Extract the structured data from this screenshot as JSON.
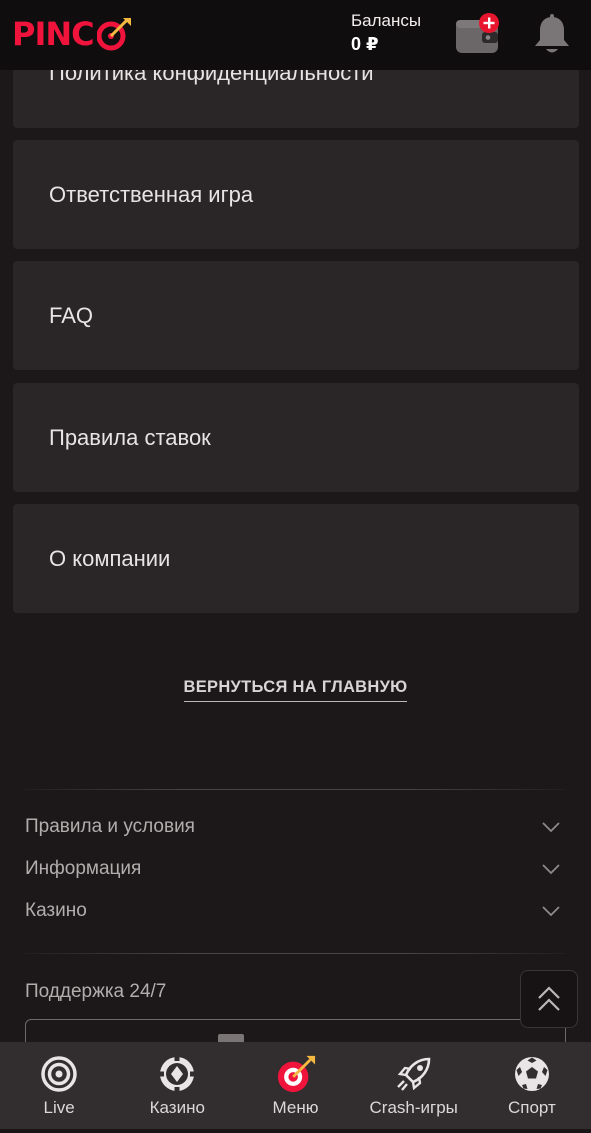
{
  "header": {
    "logo_text": "PINC",
    "balance_label": "Балансы",
    "balance_value": "0 ₽",
    "wallet_icon": "wallet-plus-icon",
    "bell_icon": "bell-icon",
    "brand_color": "#f0143c"
  },
  "menu": {
    "items": [
      {
        "label": "Политика конфиденциальности"
      },
      {
        "label": "Ответственная игра"
      },
      {
        "label": "FAQ"
      },
      {
        "label": "Правила ставок"
      },
      {
        "label": "О компании"
      }
    ],
    "back_link": "ВЕРНУТЬСЯ НА ГЛАВНУЮ"
  },
  "footer": {
    "sections": [
      {
        "label": "Правила и условия"
      },
      {
        "label": "Информация"
      },
      {
        "label": "Казино"
      }
    ],
    "support_title": "Поддержка 24/7"
  },
  "bottom_nav": {
    "items": [
      {
        "label": "Live",
        "icon": "live-icon"
      },
      {
        "label": "Казино",
        "icon": "casino-chip-icon"
      },
      {
        "label": "Меню",
        "icon": "target-dart-icon"
      },
      {
        "label": "Crash-игры",
        "icon": "rocket-icon"
      },
      {
        "label": "Спорт",
        "icon": "soccer-ball-icon"
      }
    ]
  }
}
